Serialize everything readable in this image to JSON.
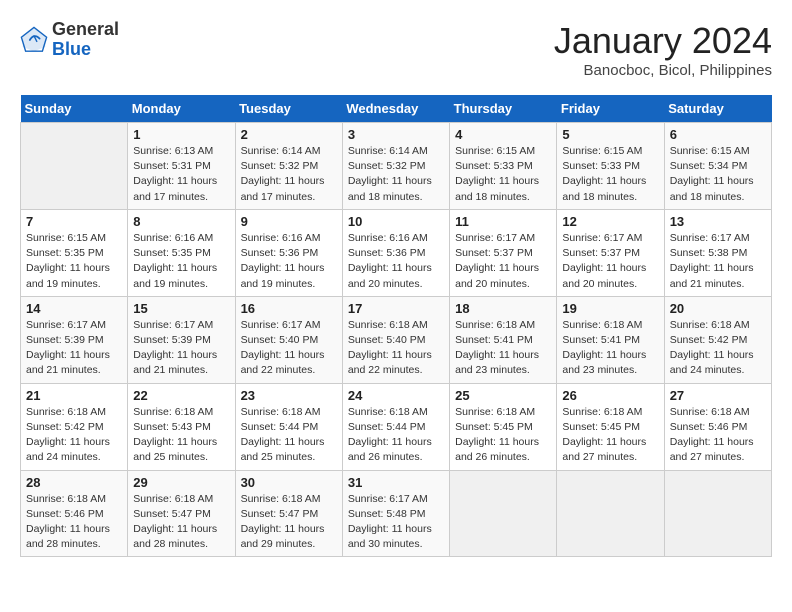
{
  "logo": {
    "general": "General",
    "blue": "Blue"
  },
  "title": "January 2024",
  "subtitle": "Banocboc, Bicol, Philippines",
  "days_of_week": [
    "Sunday",
    "Monday",
    "Tuesday",
    "Wednesday",
    "Thursday",
    "Friday",
    "Saturday"
  ],
  "weeks": [
    [
      {
        "day": "",
        "info": ""
      },
      {
        "day": "1",
        "info": "Sunrise: 6:13 AM\nSunset: 5:31 PM\nDaylight: 11 hours\nand 17 minutes."
      },
      {
        "day": "2",
        "info": "Sunrise: 6:14 AM\nSunset: 5:32 PM\nDaylight: 11 hours\nand 17 minutes."
      },
      {
        "day": "3",
        "info": "Sunrise: 6:14 AM\nSunset: 5:32 PM\nDaylight: 11 hours\nand 18 minutes."
      },
      {
        "day": "4",
        "info": "Sunrise: 6:15 AM\nSunset: 5:33 PM\nDaylight: 11 hours\nand 18 minutes."
      },
      {
        "day": "5",
        "info": "Sunrise: 6:15 AM\nSunset: 5:33 PM\nDaylight: 11 hours\nand 18 minutes."
      },
      {
        "day": "6",
        "info": "Sunrise: 6:15 AM\nSunset: 5:34 PM\nDaylight: 11 hours\nand 18 minutes."
      }
    ],
    [
      {
        "day": "7",
        "info": "Sunrise: 6:15 AM\nSunset: 5:35 PM\nDaylight: 11 hours\nand 19 minutes."
      },
      {
        "day": "8",
        "info": "Sunrise: 6:16 AM\nSunset: 5:35 PM\nDaylight: 11 hours\nand 19 minutes."
      },
      {
        "day": "9",
        "info": "Sunrise: 6:16 AM\nSunset: 5:36 PM\nDaylight: 11 hours\nand 19 minutes."
      },
      {
        "day": "10",
        "info": "Sunrise: 6:16 AM\nSunset: 5:36 PM\nDaylight: 11 hours\nand 20 minutes."
      },
      {
        "day": "11",
        "info": "Sunrise: 6:17 AM\nSunset: 5:37 PM\nDaylight: 11 hours\nand 20 minutes."
      },
      {
        "day": "12",
        "info": "Sunrise: 6:17 AM\nSunset: 5:37 PM\nDaylight: 11 hours\nand 20 minutes."
      },
      {
        "day": "13",
        "info": "Sunrise: 6:17 AM\nSunset: 5:38 PM\nDaylight: 11 hours\nand 21 minutes."
      }
    ],
    [
      {
        "day": "14",
        "info": "Sunrise: 6:17 AM\nSunset: 5:39 PM\nDaylight: 11 hours\nand 21 minutes."
      },
      {
        "day": "15",
        "info": "Sunrise: 6:17 AM\nSunset: 5:39 PM\nDaylight: 11 hours\nand 21 minutes."
      },
      {
        "day": "16",
        "info": "Sunrise: 6:17 AM\nSunset: 5:40 PM\nDaylight: 11 hours\nand 22 minutes."
      },
      {
        "day": "17",
        "info": "Sunrise: 6:18 AM\nSunset: 5:40 PM\nDaylight: 11 hours\nand 22 minutes."
      },
      {
        "day": "18",
        "info": "Sunrise: 6:18 AM\nSunset: 5:41 PM\nDaylight: 11 hours\nand 23 minutes."
      },
      {
        "day": "19",
        "info": "Sunrise: 6:18 AM\nSunset: 5:41 PM\nDaylight: 11 hours\nand 23 minutes."
      },
      {
        "day": "20",
        "info": "Sunrise: 6:18 AM\nSunset: 5:42 PM\nDaylight: 11 hours\nand 24 minutes."
      }
    ],
    [
      {
        "day": "21",
        "info": "Sunrise: 6:18 AM\nSunset: 5:42 PM\nDaylight: 11 hours\nand 24 minutes."
      },
      {
        "day": "22",
        "info": "Sunrise: 6:18 AM\nSunset: 5:43 PM\nDaylight: 11 hours\nand 25 minutes."
      },
      {
        "day": "23",
        "info": "Sunrise: 6:18 AM\nSunset: 5:44 PM\nDaylight: 11 hours\nand 25 minutes."
      },
      {
        "day": "24",
        "info": "Sunrise: 6:18 AM\nSunset: 5:44 PM\nDaylight: 11 hours\nand 26 minutes."
      },
      {
        "day": "25",
        "info": "Sunrise: 6:18 AM\nSunset: 5:45 PM\nDaylight: 11 hours\nand 26 minutes."
      },
      {
        "day": "26",
        "info": "Sunrise: 6:18 AM\nSunset: 5:45 PM\nDaylight: 11 hours\nand 27 minutes."
      },
      {
        "day": "27",
        "info": "Sunrise: 6:18 AM\nSunset: 5:46 PM\nDaylight: 11 hours\nand 27 minutes."
      }
    ],
    [
      {
        "day": "28",
        "info": "Sunrise: 6:18 AM\nSunset: 5:46 PM\nDaylight: 11 hours\nand 28 minutes."
      },
      {
        "day": "29",
        "info": "Sunrise: 6:18 AM\nSunset: 5:47 PM\nDaylight: 11 hours\nand 28 minutes."
      },
      {
        "day": "30",
        "info": "Sunrise: 6:18 AM\nSunset: 5:47 PM\nDaylight: 11 hours\nand 29 minutes."
      },
      {
        "day": "31",
        "info": "Sunrise: 6:17 AM\nSunset: 5:48 PM\nDaylight: 11 hours\nand 30 minutes."
      },
      {
        "day": "",
        "info": ""
      },
      {
        "day": "",
        "info": ""
      },
      {
        "day": "",
        "info": ""
      }
    ]
  ]
}
